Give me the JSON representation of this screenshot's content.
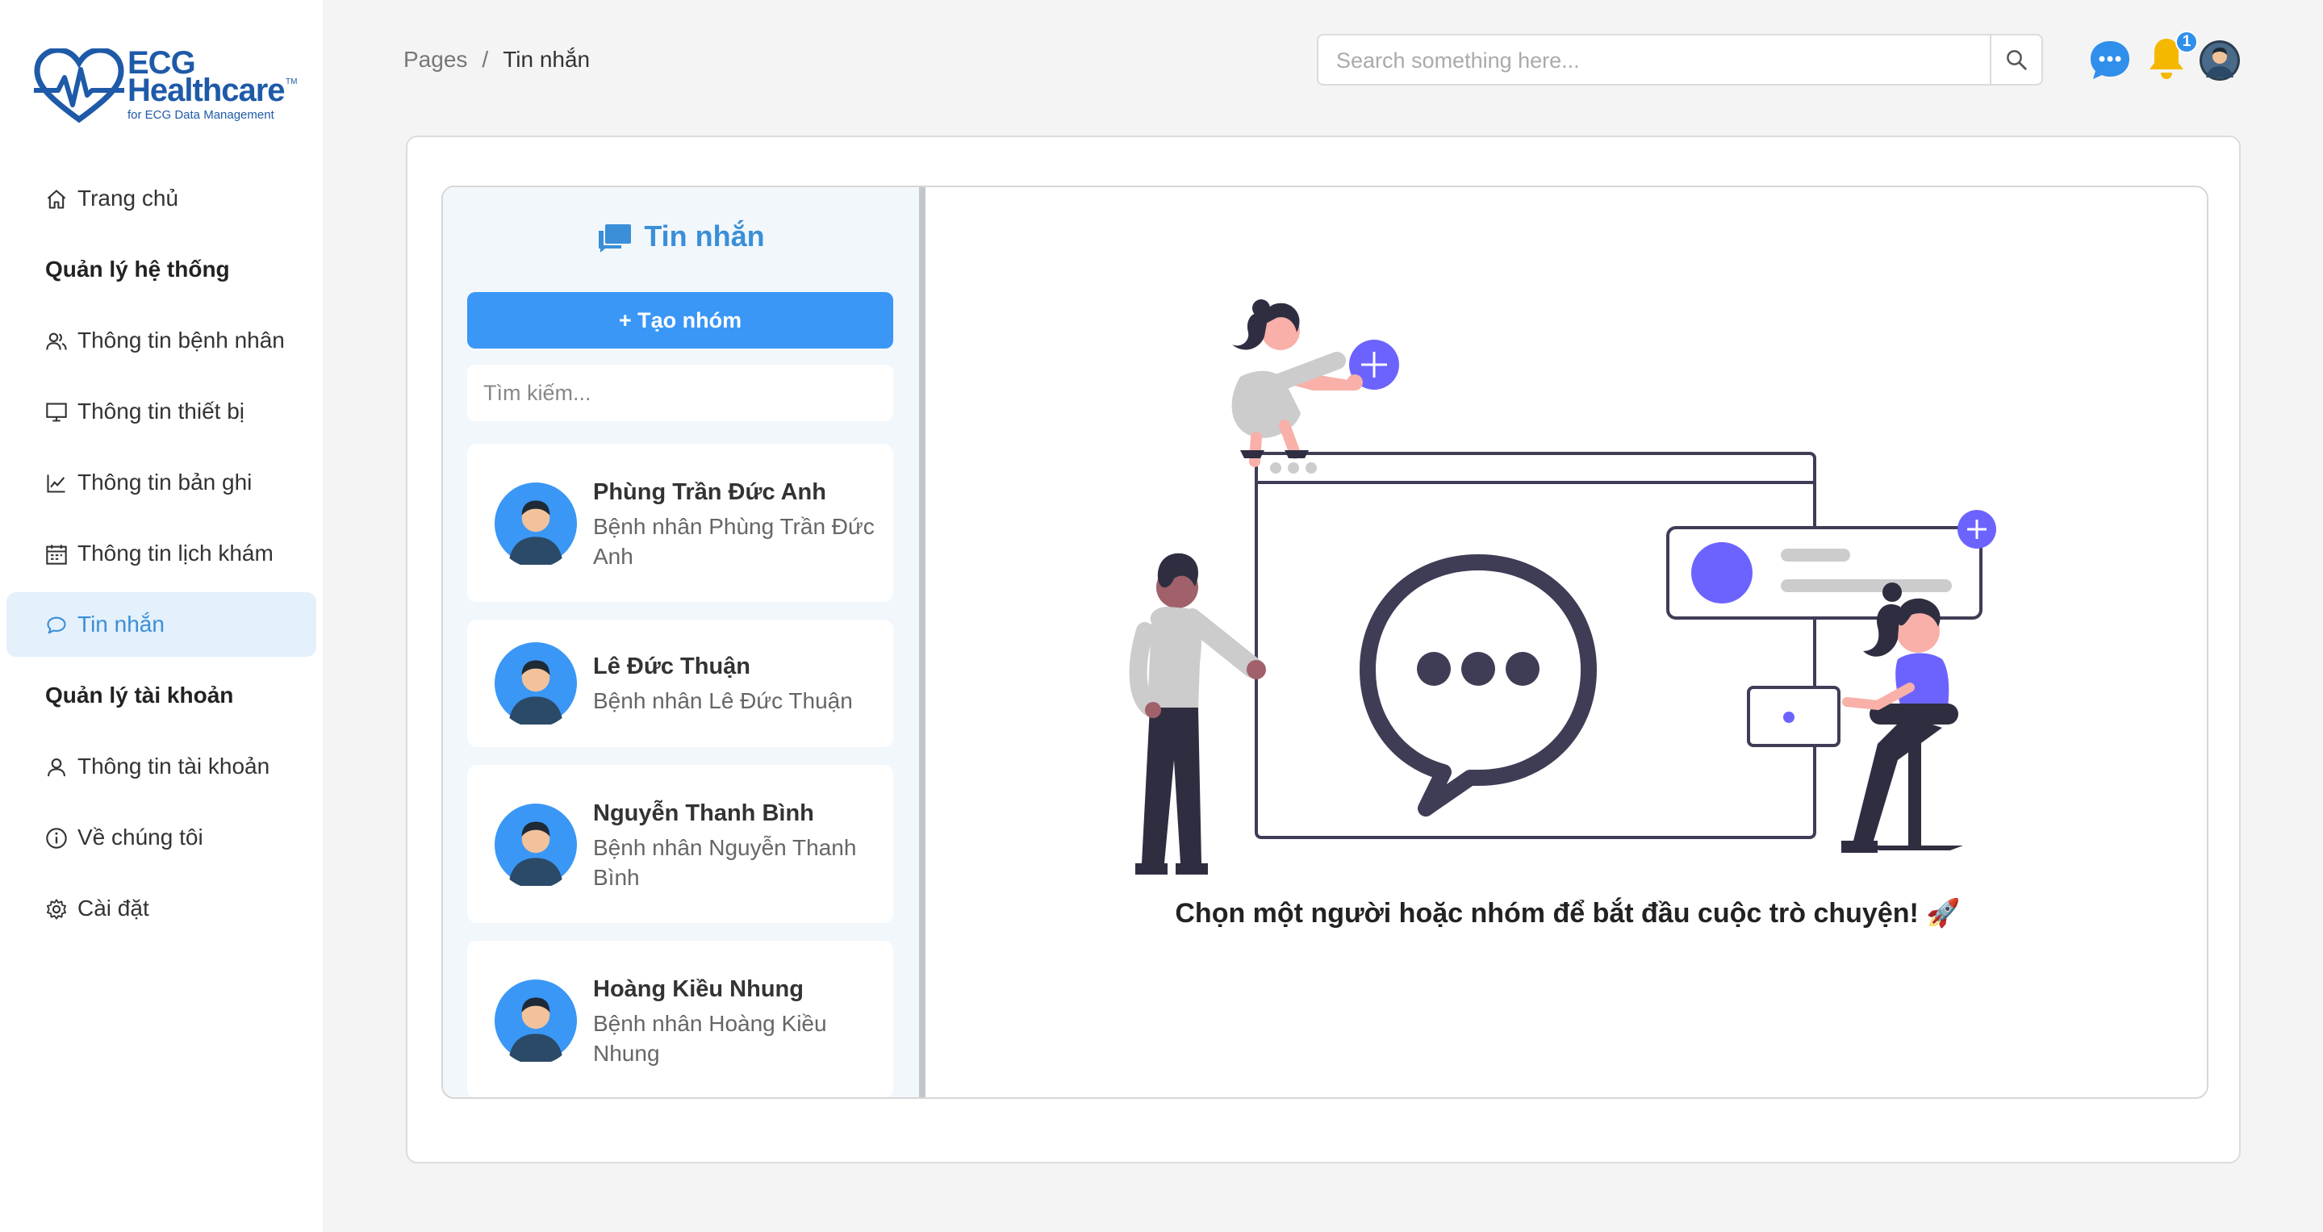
{
  "brand": {
    "line1": "ECG",
    "line2": "Healthcare",
    "tm": "TM",
    "tagline": "for ECG Data Management"
  },
  "sidebar": {
    "items": [
      {
        "label": "Trang chủ",
        "icon": "home-icon"
      },
      {
        "header": "Quản lý hệ thống"
      },
      {
        "label": "Thông tin bệnh nhân",
        "icon": "users-icon"
      },
      {
        "label": "Thông tin thiết bị",
        "icon": "monitor-icon"
      },
      {
        "label": "Thông tin bản ghi",
        "icon": "chart-line-icon"
      },
      {
        "label": "Thông tin lịch khám",
        "icon": "calendar-icon"
      },
      {
        "label": "Tin nhắn",
        "icon": "chat-icon",
        "active": true
      },
      {
        "header": "Quản lý tài khoản"
      },
      {
        "label": "Thông tin tài khoản",
        "icon": "user-icon"
      },
      {
        "label": "Về chúng tôi",
        "icon": "info-icon"
      },
      {
        "label": "Cài đặt",
        "icon": "gear-icon"
      }
    ]
  },
  "breadcrumb": {
    "root": "Pages",
    "separator": "/",
    "current": "Tin nhắn"
  },
  "search": {
    "placeholder": "Search something here..."
  },
  "header": {
    "notification_count": "1"
  },
  "chat": {
    "title": "Tin nhắn",
    "create_group_label": "+ Tạo nhóm",
    "search_placeholder": "Tìm kiếm...",
    "contacts": [
      {
        "name": "Phùng Trần Đức Anh",
        "subtitle": "Bệnh nhân Phùng Trần Đức Anh"
      },
      {
        "name": "Lê Đức Thuận",
        "subtitle": "Bệnh nhân Lê Đức Thuận"
      },
      {
        "name": "Nguyễn Thanh Bình",
        "subtitle": "Bệnh nhân Nguyễn Thanh Bình"
      },
      {
        "name": "Hoàng Kiều Nhung",
        "subtitle": "Bệnh nhân Hoàng Kiều Nhung"
      }
    ],
    "empty_prompt": "Chọn một người hoặc nhóm để bắt đầu cuộc trò chuyện! 🚀"
  },
  "colors": {
    "accent": "#3a97f5",
    "active_bg": "#e4f0fb",
    "brand": "#1e5aa8",
    "illustration_purple": "#6c63ff"
  }
}
